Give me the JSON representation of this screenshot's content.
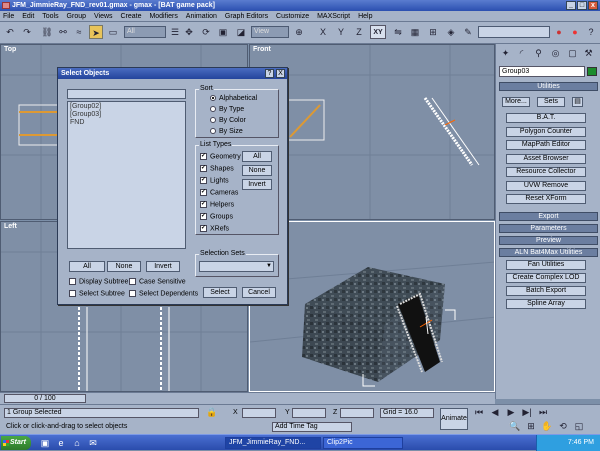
{
  "window": {
    "title": "JFM_JimmieRay_FND_rev01.gmax - gmax - [BAT game pack]",
    "min": "_",
    "max": "□",
    "close": "x"
  },
  "menu": [
    "File",
    "Edit",
    "Tools",
    "Group",
    "Views",
    "Create",
    "Modifiers",
    "Animation",
    "Graph Editors",
    "Customize",
    "MAXScript",
    "Help"
  ],
  "toolbar": {
    "selection_filter": "All",
    "view_mode": "View",
    "axis_label": "XY",
    "axis_x": "X",
    "axis_y": "Y",
    "axis_z": "Z"
  },
  "viewports": {
    "top": "Top",
    "front": "Front",
    "left": "Left",
    "perspective": "ve"
  },
  "dialog": {
    "title": "Select Objects",
    "help": "?",
    "close": "X",
    "objects": [
      "[Group02]",
      "[Group03]",
      "FND"
    ],
    "buttons": {
      "all": "All",
      "none": "None",
      "invert": "Invert",
      "select": "Select",
      "cancel": "Cancel"
    },
    "sort": {
      "title": "Sort",
      "options": [
        "Alphabetical",
        "By Type",
        "By Color",
        "By Size"
      ]
    },
    "list_types": {
      "title": "List Types",
      "items": [
        "Geometry",
        "Shapes",
        "Lights",
        "Cameras",
        "Helpers",
        "Groups",
        "XRefs"
      ],
      "all": "All",
      "none": "None",
      "invert": "Invert"
    },
    "options": {
      "display_subtree": "Display Subtree",
      "case_sensitive": "Case Sensitive",
      "select_subtree": "Select Subtree",
      "select_dependents": "Select Dependents"
    },
    "selection_sets": {
      "title": "Selection Sets"
    }
  },
  "command_panel": {
    "group_name": "Group03",
    "utilities_title": "Utilities",
    "more": "More...",
    "sets": "Sets",
    "utilities": [
      "B.A.T.",
      "Polygon Counter",
      "MapPath Editor",
      "Asset Browser",
      "Resource Collector",
      "UVW Remove",
      "Reset XForm"
    ],
    "rollouts": [
      "Export",
      "Parameters",
      "Preview"
    ],
    "aln_title": "ALN Bat4Max Utilities",
    "aln_items": [
      "Fan Utilities",
      "Create Complex LOD",
      "Batch Export",
      "Spline Array"
    ],
    "color": "#1c8c2c"
  },
  "timeline": {
    "slider": "0 / 100"
  },
  "status": {
    "selection": "1 Group Selected",
    "prompt": "Click or click-and-drag to select objects",
    "x_label": "X",
    "y_label": "Y",
    "z_label": "Z",
    "grid": "Grid = 16.0",
    "add_time_tag": "Add Time Tag",
    "animate": "Animate"
  },
  "taskbar": {
    "start": "Start",
    "items": [
      "JFM_JimmieRay_FND...",
      "Clip2Pic"
    ],
    "clock": "7:46 PM"
  }
}
